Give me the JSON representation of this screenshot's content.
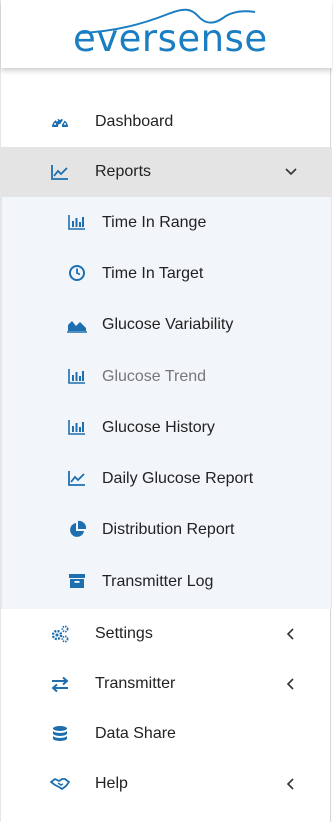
{
  "brand": {
    "name": "eversense",
    "color": "#1b7dc2"
  },
  "menu": {
    "dashboard": {
      "label": "Dashboard",
      "icon": "dashboard-gauge-icon"
    },
    "reports": {
      "label": "Reports",
      "icon": "line-chart-icon",
      "expanded": true,
      "items": [
        {
          "label": "Time In Range",
          "icon": "bar-chart-icon"
        },
        {
          "label": "Time In Target",
          "icon": "clock-icon"
        },
        {
          "label": "Glucose Variability",
          "icon": "area-chart-icon"
        },
        {
          "label": "Glucose Trend",
          "icon": "bar-chart-icon",
          "muted": true
        },
        {
          "label": "Glucose History",
          "icon": "bar-chart-icon"
        },
        {
          "label": "Daily Glucose Report",
          "icon": "line-chart-icon"
        },
        {
          "label": "Distribution Report",
          "icon": "pie-chart-icon"
        },
        {
          "label": "Transmitter Log",
          "icon": "archive-icon"
        }
      ]
    },
    "settings": {
      "label": "Settings",
      "icon": "gears-icon"
    },
    "transmitter": {
      "label": "Transmitter",
      "icon": "exchange-arrows-icon"
    },
    "data_share": {
      "label": "Data Share",
      "icon": "database-icon"
    },
    "help": {
      "label": "Help",
      "icon": "handshake-icon"
    }
  },
  "colors": {
    "icon_blue": "#1e6fb0",
    "active_bg": "#e4e4e4",
    "submenu_bg": "#f2f6fa"
  }
}
